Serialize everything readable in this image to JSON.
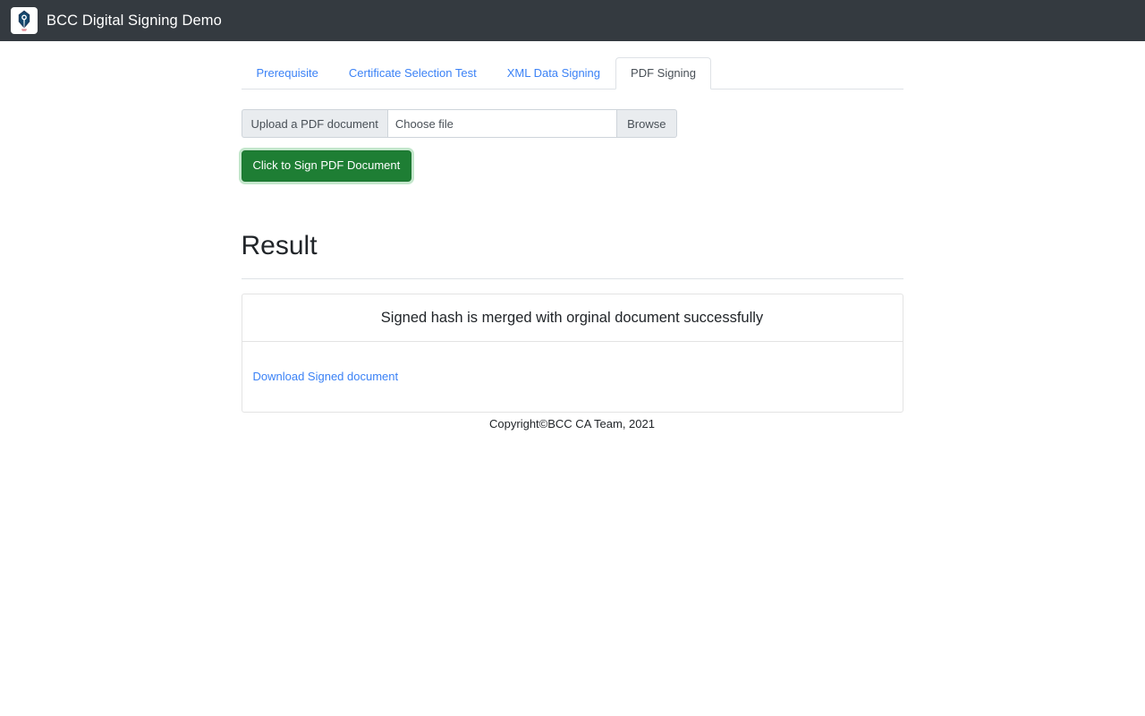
{
  "navbar": {
    "brand_title": "BCC Digital Signing Demo",
    "logo_icon": "pen-nib-icon",
    "background_color": "#343a40"
  },
  "tabs": [
    {
      "label": "Prerequisite",
      "active": false
    },
    {
      "label": "Certificate Selection Test",
      "active": false
    },
    {
      "label": "XML Data Signing",
      "active": false
    },
    {
      "label": "PDF Signing",
      "active": true
    }
  ],
  "upload": {
    "label": "Upload a PDF document",
    "file_value": "",
    "file_placeholder": "Choose file",
    "browse_label": "Browse"
  },
  "actions": {
    "sign_button_label": "Click to Sign PDF Document",
    "sign_button_color": "#1e7e34"
  },
  "result": {
    "heading": "Result",
    "message": "Signed hash is merged with orginal document successfully",
    "download_link_label": "Download Signed document",
    "link_color": "#3b82f6"
  },
  "footer": {
    "copyright": "Copyright©BCC CA Team, 2021"
  }
}
